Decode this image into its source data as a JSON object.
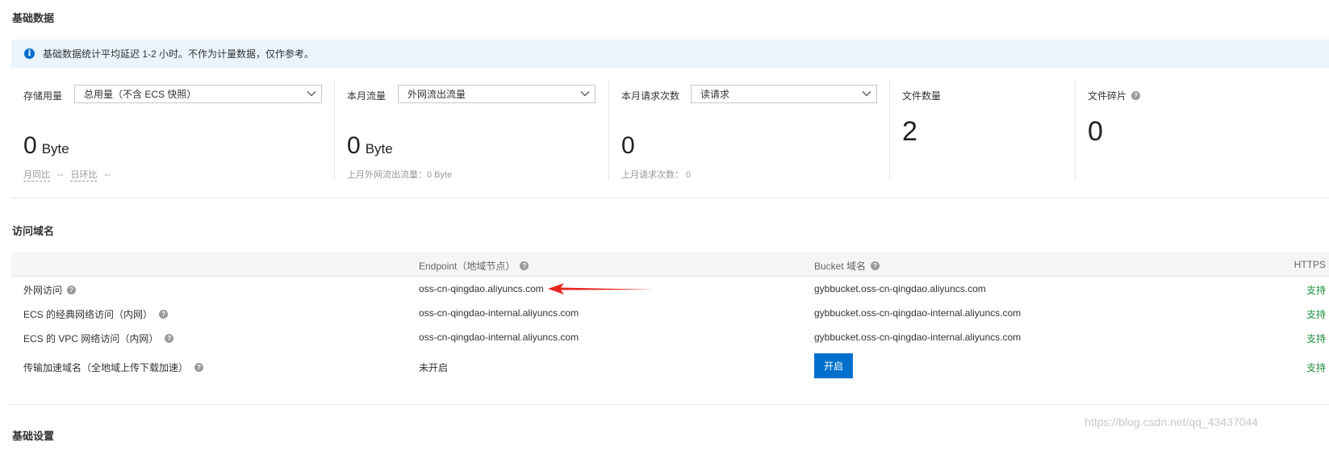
{
  "sections": {
    "basic_data": "基础数据",
    "access_domain": "访问域名",
    "basic_settings": "基础设置"
  },
  "notice": {
    "icon": "info-icon",
    "text": "基础数据统计平均延迟 1-2 小时。不作为计量数据，仅作参考。"
  },
  "stats": {
    "storage": {
      "label": "存储用量",
      "select_value": "总用量（不含 ECS 快照）",
      "value": "0",
      "unit": "Byte",
      "mom_label": "月同比",
      "mom_value": "--",
      "dod_label": "日环比",
      "dod_value": "--"
    },
    "traffic": {
      "label": "本月流量",
      "select_value": "外网流出流量",
      "value": "0",
      "unit": "Byte",
      "sub": "上月外网流出流量：0 Byte"
    },
    "requests": {
      "label": "本月请求次数",
      "select_value": "读请求",
      "value": "0",
      "sub": "上月请求次数：  0"
    },
    "files": {
      "label": "文件数量",
      "value": "2"
    },
    "fragments": {
      "label": "文件碎片",
      "value": "0"
    }
  },
  "table": {
    "headers": {
      "endpoint": "Endpoint（地域节点）",
      "bucket": "Bucket 域名",
      "https": "HTTPS"
    },
    "rows": [
      {
        "name": "外网访问",
        "endpoint": "oss-cn-qingdao.aliyuncs.com",
        "bucket": "gybbucket.oss-cn-qingdao.aliyuncs.com",
        "https": "支持"
      },
      {
        "name": "ECS 的经典网络访问（内网）",
        "endpoint": "oss-cn-qingdao-internal.aliyuncs.com",
        "bucket": "gybbucket.oss-cn-qingdao-internal.aliyuncs.com",
        "https": "支持"
      },
      {
        "name": "ECS 的 VPC 网络访问（内网）",
        "endpoint": "oss-cn-qingdao-internal.aliyuncs.com",
        "bucket": "gybbucket.oss-cn-qingdao-internal.aliyuncs.com",
        "https": "支持"
      },
      {
        "name": "传输加速域名（全地域上传下载加速）",
        "endpoint": "未开启",
        "button": "开启",
        "https": "支持"
      }
    ]
  },
  "watermark": "https://blog.csdn.net/qq_43437044",
  "colors": {
    "primary": "#0070cc",
    "notice_bg": "#e9f4fd",
    "support_green": "#1e8e3e",
    "arrow_red": "#e8251f"
  }
}
